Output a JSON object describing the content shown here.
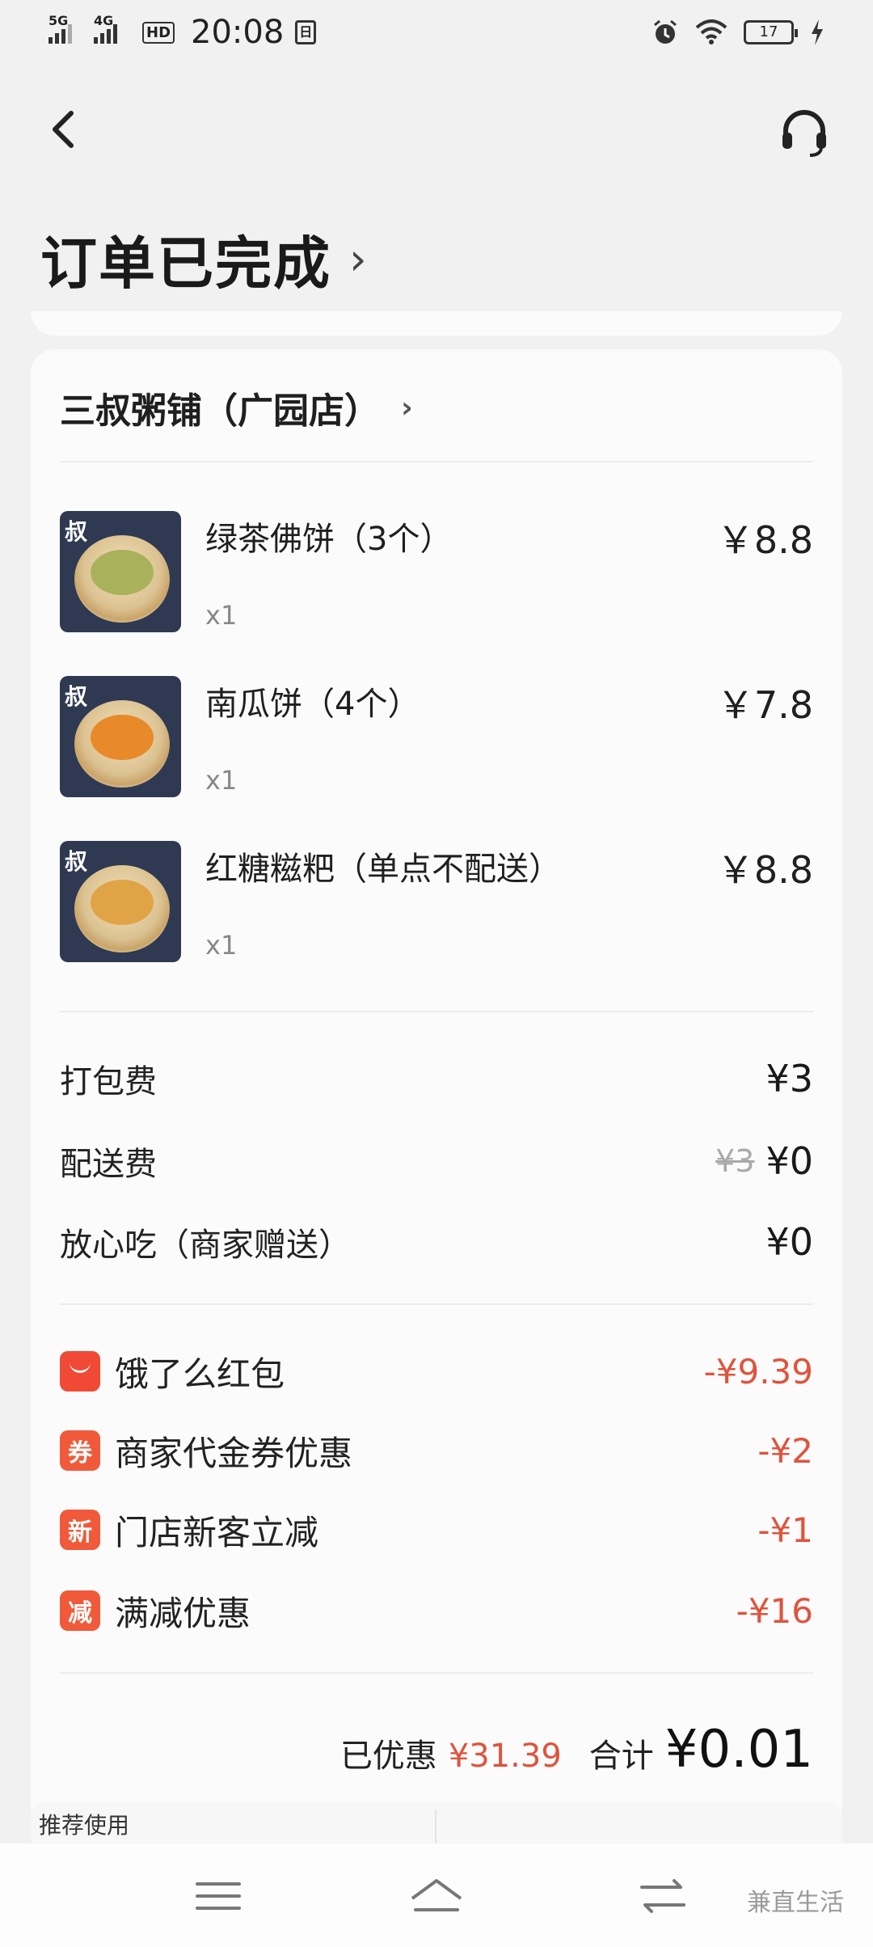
{
  "status": {
    "net1": "5G",
    "net2": "4G",
    "hd": "HD",
    "time": "20:08",
    "small_badge": "日",
    "battery": "17"
  },
  "header": {
    "title": "订单已完成",
    "title_chevron": "›"
  },
  "shop": {
    "name": "三叔粥铺（广园店）",
    "chevron": "›"
  },
  "items": [
    {
      "name": "绿茶佛饼（3个）",
      "qty": "x1",
      "price": "￥8.8",
      "thumb_mark": "叔"
    },
    {
      "name": "南瓜饼（4个）",
      "qty": "x1",
      "price": "￥7.8",
      "thumb_mark": "叔"
    },
    {
      "name": "红糖糍粑（单点不配送）",
      "qty": "x1",
      "price": "￥8.8",
      "thumb_mark": "叔"
    }
  ],
  "fees": [
    {
      "label": "打包费",
      "value": "¥3",
      "original": ""
    },
    {
      "label": "配送费",
      "value": "¥0",
      "original": "¥3"
    },
    {
      "label": "放心吃（商家赠送）",
      "value": "¥0",
      "original": ""
    }
  ],
  "discounts": [
    {
      "icon": "",
      "label": "饿了么红包",
      "value": "-¥9.39"
    },
    {
      "icon": "券",
      "label": "商家代金券优惠",
      "value": "-¥2"
    },
    {
      "icon": "新",
      "label": "门店新客立减",
      "value": "-¥1"
    },
    {
      "icon": "减",
      "label": "满减优惠",
      "value": "-¥16"
    }
  ],
  "summary": {
    "saved_label": "已优惠",
    "saved_value": "¥31.39",
    "total_label": "合计",
    "total_value": "¥0.01"
  },
  "recommend": {
    "tag": "推荐使用"
  },
  "watermark": "兼直生活",
  "colors": {
    "accent_red": "#e0533c",
    "icon_red": "#f05a3a",
    "background": "#f1f1f1",
    "card": "#fbfbfb"
  }
}
